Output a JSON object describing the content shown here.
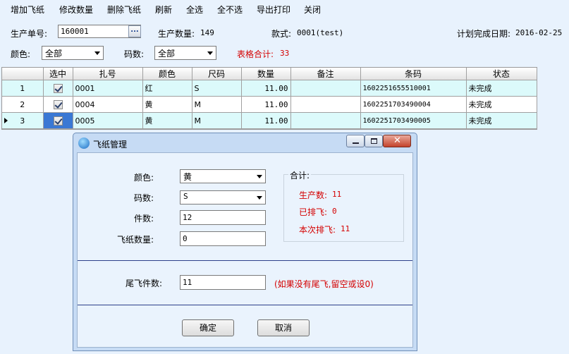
{
  "toolbar": {
    "items": [
      "增加飞纸",
      "修改数量",
      "删除飞纸",
      "刷新",
      "全选",
      "全不选",
      "导出打印",
      "关闭"
    ]
  },
  "form": {
    "order_label": "生产单号:",
    "order_value": "160001",
    "browse_label": "...",
    "qty_label": "生产数量:",
    "qty_value": "149",
    "style_label": "款式:",
    "style_value": "0001(test)",
    "date_label": "计划完成日期:",
    "date_value": "2016-02-25",
    "color_label": "颜色:",
    "color_value": "全部",
    "size_label": "码数:",
    "size_value": "全部",
    "total_label": "表格合计:",
    "total_value": "33"
  },
  "grid": {
    "columns": [
      "",
      "选中",
      "扎号",
      "颜色",
      "尺码",
      "数量",
      "备注",
      "条码",
      "状态"
    ],
    "rows": [
      {
        "idx": "1",
        "bundle": "0001",
        "color": "红",
        "size": "S",
        "qty": "11.00",
        "note": "",
        "barcode": "1602251655510001",
        "status": "未完成"
      },
      {
        "idx": "2",
        "bundle": "0004",
        "color": "黄",
        "size": "M",
        "qty": "11.00",
        "note": "",
        "barcode": "1602251703490004",
        "status": "未完成"
      },
      {
        "idx": "3",
        "bundle": "0005",
        "color": "黄",
        "size": "M",
        "qty": "11.00",
        "note": "",
        "barcode": "1602251703490005",
        "status": "未完成"
      }
    ]
  },
  "dialog": {
    "title": "飞纸管理",
    "color_label": "颜色:",
    "color_value": "黄",
    "size_label": "码数:",
    "size_value": "S",
    "pieces_label": "件数:",
    "pieces_value": "12",
    "tickets_label": "飞纸数量:",
    "tickets_value": "0",
    "summary_title": "合计:",
    "produced_label": "生产数:",
    "produced_value": "11",
    "scheduled_label": "已排飞:",
    "scheduled_value": "0",
    "this_label": "本次排飞:",
    "this_value": "11",
    "tail_label": "尾飞件数:",
    "tail_value": "11",
    "tail_hint": "(如果没有尾飞,留空或设0)",
    "ok_label": "确定",
    "cancel_label": "取消"
  },
  "colors": {
    "background": "#e8f2fd",
    "row_highlight": "#dcfafb",
    "accent_red": "#d40000",
    "selection": "#3a78d4"
  }
}
